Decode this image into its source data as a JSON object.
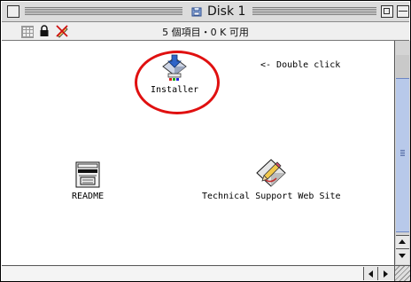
{
  "window": {
    "title": "Disk 1",
    "info": "5 個項目・0 K 可用"
  },
  "items": [
    {
      "label": "Installer",
      "icon": "installer-icon"
    },
    {
      "label": "README",
      "icon": "document-icon"
    },
    {
      "label": "Technical Support Web Site",
      "icon": "web-link-icon"
    }
  ],
  "annotation": {
    "text": "<- Double click",
    "highlight_color": "#e01010"
  },
  "colors": {
    "scroll_thumb": "#b8c9ea",
    "title_bar": "#dcdcdc"
  }
}
